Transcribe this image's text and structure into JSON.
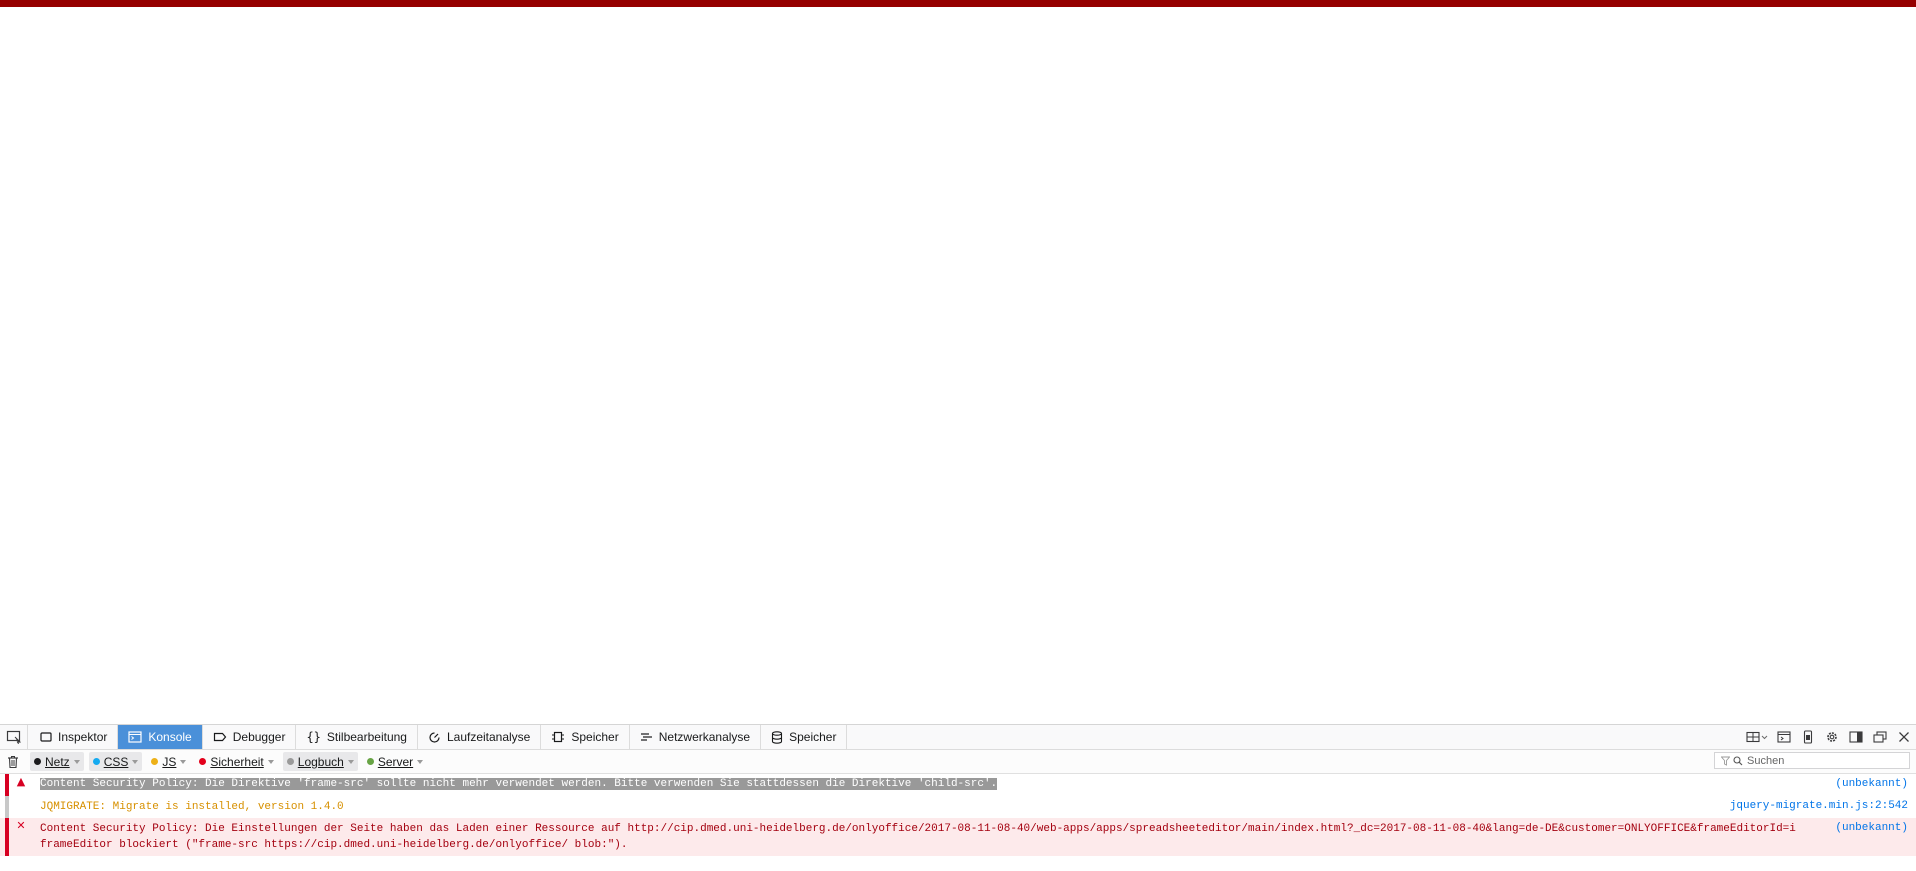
{
  "theme": {
    "accent_bar": "#960000",
    "tab_selected": "#4a90d9",
    "error_bg": "#fdeaeb",
    "error_text": "#a4000f",
    "warning_text": "#d79000",
    "link": "#0074e8"
  },
  "devtools": {
    "tabs": [
      {
        "label": "Inspektor",
        "icon": "inspector-icon"
      },
      {
        "label": "Konsole",
        "icon": "console-icon",
        "selected": true
      },
      {
        "label": "Debugger",
        "icon": "debugger-icon"
      },
      {
        "label": "Stilbearbeitung",
        "icon": "braces-icon"
      },
      {
        "label": "Laufzeitanalyse",
        "icon": "performance-icon"
      },
      {
        "label": "Speicher",
        "icon": "memory-chip-icon"
      },
      {
        "label": "Netzwerkanalyse",
        "icon": "network-icon"
      },
      {
        "label": "Speicher",
        "icon": "storage-database-icon"
      }
    ],
    "toolbar_right_icons": [
      "frames-icon",
      "scratchpad-icon",
      "responsive-design-icon",
      "settings-gear-icon",
      "dock-side-icon",
      "undock-window-icon",
      "close-icon"
    ]
  },
  "filters": {
    "buttons": [
      {
        "label": "Netz",
        "color": "#1b1b1d",
        "active": true
      },
      {
        "label": "CSS",
        "color": "#14aaf0",
        "active": true
      },
      {
        "label": "JS",
        "color": "#edb118",
        "active": false
      },
      {
        "label": "Sicherheit",
        "color": "#e3001b",
        "active": false
      },
      {
        "label": "Logbuch",
        "color": "#9a9a9a",
        "active": true
      },
      {
        "label": "Server",
        "color": "#68a445",
        "active": false
      }
    ],
    "search_placeholder": "Suchen"
  },
  "messages": [
    {
      "level": "warning",
      "text": "Content Security Policy: Die Direktive 'frame-src' sollte nicht mehr verwendet werden. Bitte verwenden Sie stattdessen die Direktive 'child-src'.",
      "location": "(unbekannt)"
    },
    {
      "level": "info",
      "text": "JQMIGRATE: Migrate is installed, version 1.4.0",
      "location": "jquery-migrate.min.js:2:542"
    },
    {
      "level": "error",
      "text": "Content Security Policy: Die Einstellungen der Seite haben das Laden einer Ressource auf http://cip.dmed.uni-heidelberg.de/onlyoffice/2017-08-11-08-40/web-apps/apps/spreadsheeteditor/main/index.html?_dc=2017-08-11-08-40&lang=de-DE&customer=ONLYOFFICE&frameEditorId=iframeEditor blockiert (\"frame-src https://cip.dmed.uni-heidelberg.de/onlyoffice/ blob:\").",
      "location": "(unbekannt)"
    }
  ]
}
